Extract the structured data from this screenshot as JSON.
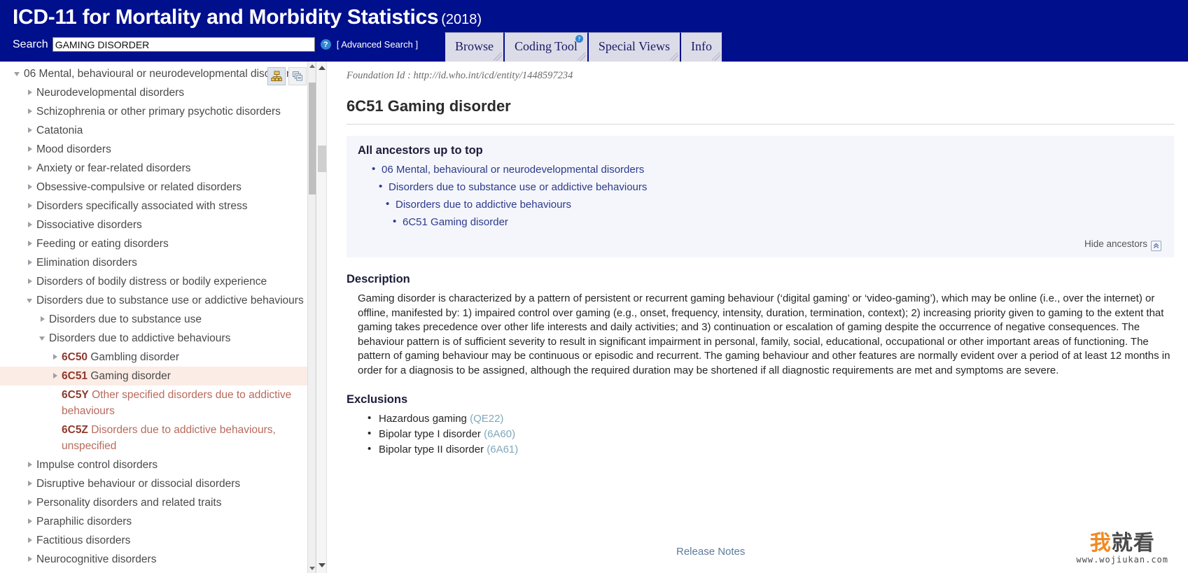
{
  "header": {
    "brand_title": "ICD-11 for Mortality and Morbidity Statistics",
    "brand_year": "(2018)",
    "search_label": "Search",
    "search_value": "GAMING DISORDER",
    "search_placeholder": "",
    "help_icon_glyph": "?",
    "advanced_search_label": "[ Advanced Search ]",
    "tabs": [
      {
        "label": "Browse",
        "badge": ""
      },
      {
        "label": "Coding Tool",
        "badge": "?"
      },
      {
        "label": "Special Views",
        "badge": ""
      },
      {
        "label": "Info",
        "badge": ""
      }
    ]
  },
  "sidebar": {
    "tools": [
      {
        "name": "hierarchy-view-icon",
        "state": "active"
      },
      {
        "name": "collapse-all-icon",
        "state": "inactive"
      }
    ],
    "tree": [
      {
        "label": "06 Mental, behavioural or neurodevelopmental disorders",
        "indent": 0,
        "state": "open",
        "style": "normal"
      },
      {
        "label": "Neurodevelopmental disorders",
        "indent": 1,
        "state": "closed",
        "style": "normal"
      },
      {
        "label": "Schizophrenia or other primary psychotic disorders",
        "indent": 1,
        "state": "closed",
        "style": "normal"
      },
      {
        "label": "Catatonia",
        "indent": 1,
        "state": "closed",
        "style": "normal"
      },
      {
        "label": "Mood disorders",
        "indent": 1,
        "state": "closed",
        "style": "normal"
      },
      {
        "label": "Anxiety or fear-related disorders",
        "indent": 1,
        "state": "closed",
        "style": "normal"
      },
      {
        "label": "Obsessive-compulsive or related disorders",
        "indent": 1,
        "state": "closed",
        "style": "normal"
      },
      {
        "label": "Disorders specifically associated with stress",
        "indent": 1,
        "state": "closed",
        "style": "normal"
      },
      {
        "label": "Dissociative disorders",
        "indent": 1,
        "state": "closed",
        "style": "normal"
      },
      {
        "label": "Feeding or eating disorders",
        "indent": 1,
        "state": "closed",
        "style": "normal"
      },
      {
        "label": "Elimination disorders",
        "indent": 1,
        "state": "closed",
        "style": "normal"
      },
      {
        "label": "Disorders of bodily distress or bodily experience",
        "indent": 1,
        "state": "closed",
        "style": "normal"
      },
      {
        "label": "Disorders due to substance use or addictive behaviours",
        "indent": 1,
        "state": "open",
        "style": "normal"
      },
      {
        "label": "Disorders due to substance use",
        "indent": 2,
        "state": "closed",
        "style": "normal"
      },
      {
        "label": "Disorders due to addictive behaviours",
        "indent": 2,
        "state": "open",
        "style": "normal"
      },
      {
        "code": "6C50",
        "label": "Gambling disorder",
        "indent": 3,
        "state": "closed",
        "style": "normal"
      },
      {
        "code": "6C51",
        "label": "Gaming disorder",
        "indent": 3,
        "state": "closed",
        "style": "selected"
      },
      {
        "code": "6C5Y",
        "label": "Other specified disorders due to addictive behaviours",
        "indent": 3,
        "state": "none",
        "style": "red"
      },
      {
        "code": "6C5Z",
        "label": "Disorders due to addictive behaviours, unspecified",
        "indent": 3,
        "state": "none",
        "style": "red"
      },
      {
        "label": "Impulse control disorders",
        "indent": 1,
        "state": "closed",
        "style": "normal"
      },
      {
        "label": "Disruptive behaviour or dissocial disorders",
        "indent": 1,
        "state": "closed",
        "style": "normal"
      },
      {
        "label": "Personality disorders and related traits",
        "indent": 1,
        "state": "closed",
        "style": "normal"
      },
      {
        "label": "Paraphilic disorders",
        "indent": 1,
        "state": "closed",
        "style": "normal"
      },
      {
        "label": "Factitious disorders",
        "indent": 1,
        "state": "closed",
        "style": "normal"
      },
      {
        "label": "Neurocognitive disorders",
        "indent": 1,
        "state": "closed",
        "style": "normal"
      }
    ]
  },
  "main": {
    "foundation_id": "Foundation Id : http://id.who.int/icd/entity/1448597234",
    "entity_title": "6C51 Gaming disorder",
    "ancestors_title": "All ancestors up to top",
    "ancestors": [
      {
        "label": "06 Mental, behavioural or neurodevelopmental disorders",
        "level": 0
      },
      {
        "label": "Disorders due to substance use or addictive behaviours",
        "level": 1
      },
      {
        "label": "Disorders due to addictive behaviours",
        "level": 2
      },
      {
        "label": "6C51 Gaming disorder",
        "level": 3
      }
    ],
    "hide_ancestors_label": "Hide ancestors",
    "hide_ancestors_icon_glyph": "»",
    "description_title": "Description",
    "description_text": "Gaming disorder is characterized by a pattern of persistent or recurrent gaming behaviour (‘digital gaming’ or ‘video-gaming’), which may be online (i.e., over the internet) or offline, manifested by: 1) impaired control over gaming (e.g., onset, frequency, intensity, duration, termination, context); 2) increasing priority given to gaming to the extent that gaming takes precedence over other life interests and daily activities; and 3) continuation or escalation of gaming despite the occurrence of negative consequences. The behaviour pattern is of sufficient severity to result in significant impairment in personal, family, social, educational, occupational or other important areas of functioning. The pattern of gaming behaviour may be continuous or episodic and recurrent. The gaming behaviour and other features are normally evident over a period of at least 12 months in order for a diagnosis to be assigned, although the required duration may be shortened if all diagnostic requirements are met and symptoms are severe.",
    "exclusions_title": "Exclusions",
    "exclusions": [
      {
        "label": "Hazardous gaming",
        "code": "(QE22)"
      },
      {
        "label": "Bipolar type I disorder",
        "code": "(6A60)"
      },
      {
        "label": "Bipolar type II disorder",
        "code": "(6A61)"
      }
    ],
    "release_notes_label": "Release Notes"
  },
  "watermark": {
    "cjk_first": "我",
    "cjk_rest": "就看",
    "url": "www.wojiukan.com"
  },
  "colors": {
    "header_blue": "#000f8c",
    "tab_face": "#dcdce8",
    "selected_row": "#fbece6",
    "ancestor_link": "#2d3a8c",
    "code_red": "#8f3a2e",
    "exclusion_code": "#7fa8bd",
    "release_notes": "#5b7c9d",
    "watermark_orange": "#f08a24"
  }
}
